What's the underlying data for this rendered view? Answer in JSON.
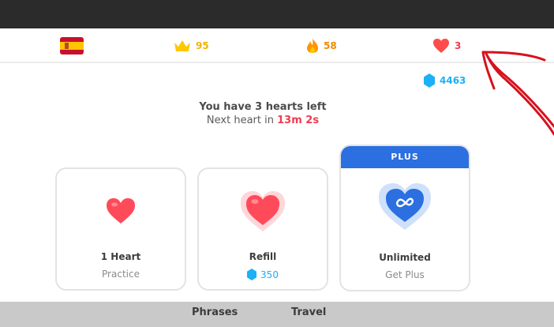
{
  "status_bar": {
    "flag_icon": "spain-flag-icon",
    "crowns": {
      "icon": "crown-icon",
      "value": "95",
      "color": "#f0b400"
    },
    "streak": {
      "icon": "flame-icon",
      "value": "58",
      "color": "#f08a00"
    },
    "hearts": {
      "icon": "heart-icon",
      "value": "3",
      "color": "#ef3b4f"
    }
  },
  "gems": {
    "icon": "gem-icon",
    "value": "4463",
    "color": "#1cb0f6"
  },
  "message": {
    "line1": "You have 3 hearts left",
    "line2_prefix": "Next heart in ",
    "timer": "13m 2s"
  },
  "options": [
    {
      "title": "1 Heart",
      "subtitle": "Practice",
      "icon": "heart-icon"
    },
    {
      "title": "Refill",
      "price": "350",
      "icon": "big-heart-icon"
    },
    {
      "badge": "PLUS",
      "title": "Unlimited",
      "subtitle": "Get Plus",
      "icon": "infinity-heart-icon"
    }
  ],
  "bottom_tabs": [
    "Phrases",
    "Travel"
  ],
  "colors": {
    "accent_blue": "#2b6fe0",
    "heart_red": "#ef3b4f",
    "gem_blue": "#1cb0f6",
    "annotation_red": "#d6121e"
  }
}
